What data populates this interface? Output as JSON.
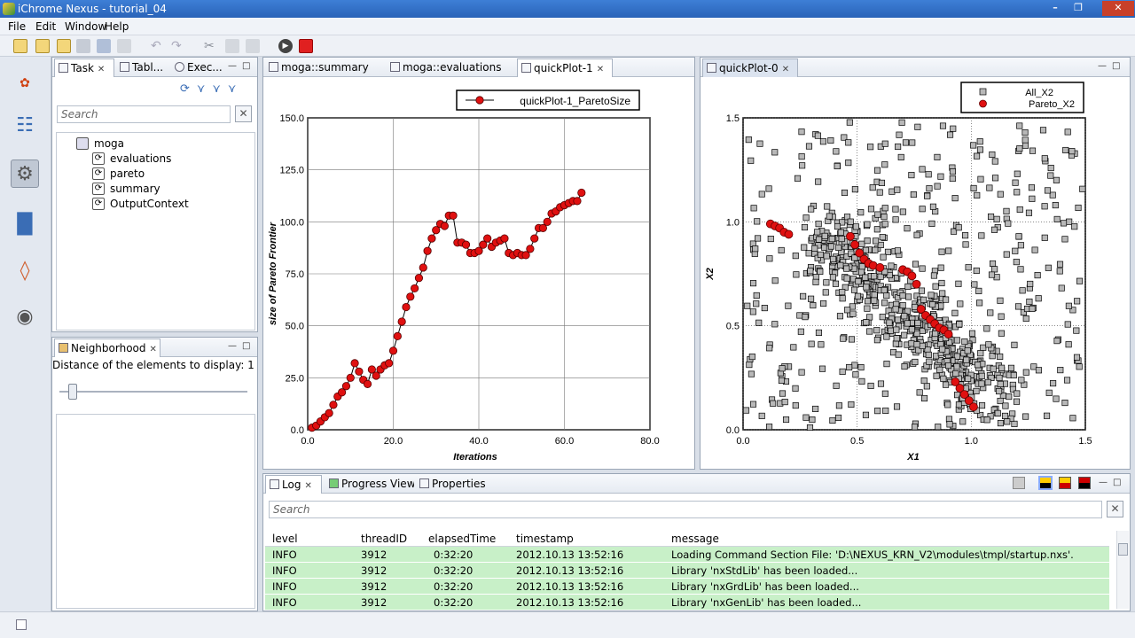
{
  "window": {
    "title": "iChrome Nexus - tutorial_04"
  },
  "menu": [
    "File",
    "Edit",
    "Window",
    "Help"
  ],
  "left_panel": {
    "tabs": [
      {
        "label": "Task",
        "active": true
      },
      {
        "label": "Tabl...",
        "active": false
      },
      {
        "label": "Exec...",
        "active": false
      }
    ],
    "search_placeholder": "Search",
    "tree": {
      "root": "moga",
      "children": [
        "evaluations",
        "pareto",
        "summary",
        "OutputContext"
      ]
    }
  },
  "neighborhood": {
    "tab": "Neighborhood",
    "label": "Distance of the elements to display: 1",
    "slider_value": 1
  },
  "editor_tabs": [
    {
      "label": "moga::summary",
      "active": false
    },
    {
      "label": "moga::evaluations",
      "active": false
    },
    {
      "label": "quickPlot-1",
      "active": true
    }
  ],
  "right_tab": {
    "label": "quickPlot-0"
  },
  "log": {
    "tabs": [
      "Log",
      "Progress View",
      "Properties"
    ],
    "search_placeholder": "Search",
    "columns": [
      "level",
      "threadID",
      "elapsedTime",
      "timestamp",
      "message"
    ],
    "rows": [
      [
        "INFO",
        "3912",
        "0:32:20",
        "2012.10.13 13:52:16",
        "Loading Command Section File: 'D:\\NEXUS_KRN_V2\\modules\\tmpl/startup.nxs'."
      ],
      [
        "INFO",
        "3912",
        "0:32:20",
        "2012.10.13 13:52:16",
        "Library 'nxStdLib' has been loaded..."
      ],
      [
        "INFO",
        "3912",
        "0:32:20",
        "2012.10.13 13:52:16",
        "Library 'nxGrdLib' has been loaded..."
      ],
      [
        "INFO",
        "3912",
        "0:32:20",
        "2012.10.13 13:52:16",
        "Library 'nxGenLib' has been loaded..."
      ]
    ]
  },
  "colors": {
    "accent": "#2a63b8",
    "log_row": "#c8f0c8",
    "marker_red": "#e01010",
    "marker_gray": "#b8b8b8"
  },
  "chart_data": [
    {
      "type": "line",
      "legend": [
        "quickPlot-1_ParetoSize"
      ],
      "legend_placement": "top-right",
      "xlabel": "Iterations",
      "ylabel": "size of Pareto Frontier",
      "xlim": [
        0,
        80
      ],
      "ylim": [
        0,
        150
      ],
      "xticks": [
        "0.0",
        "20.0",
        "40.0",
        "60.0",
        "80.0"
      ],
      "yticks": [
        "0.0",
        "25.0",
        "50.0",
        "75.0",
        "100.0",
        "125.0",
        "150.0"
      ],
      "grid": true,
      "series": [
        {
          "name": "quickPlot-1_ParetoSize",
          "x": [
            1,
            2,
            3,
            4,
            5,
            6,
            7,
            8,
            9,
            10,
            11,
            12,
            13,
            14,
            15,
            16,
            17,
            18,
            19,
            20,
            21,
            22,
            23,
            24,
            25,
            26,
            27,
            28,
            29,
            30,
            31,
            32,
            33,
            34,
            35,
            36,
            37,
            38,
            39,
            40,
            41,
            42,
            43,
            44,
            45,
            46,
            47,
            48,
            49,
            50,
            51,
            52,
            53,
            54,
            55,
            56,
            57,
            58,
            59,
            60,
            61,
            62,
            63,
            64
          ],
          "y": [
            1,
            2,
            4,
            6,
            8,
            12,
            16,
            18,
            21,
            25,
            32,
            28,
            24,
            22,
            29,
            26,
            29,
            31,
            32,
            38,
            45,
            52,
            59,
            64,
            68,
            73,
            78,
            86,
            92,
            96,
            99,
            98,
            103,
            103,
            90,
            90,
            89,
            85,
            85,
            86,
            89,
            92,
            88,
            90,
            91,
            92,
            85,
            84,
            85,
            84,
            84,
            87,
            92,
            97,
            97,
            100,
            104,
            105,
            107,
            108,
            109,
            110,
            110,
            114
          ]
        }
      ]
    },
    {
      "type": "scatter",
      "legend": [
        "All_X2",
        "Pareto_X2"
      ],
      "legend_placement": "top-right",
      "xlabel": "X1",
      "ylabel": "X2",
      "xlim": [
        0,
        1.5
      ],
      "ylim": [
        0,
        1.5
      ],
      "xticks": [
        "0.0",
        "0.5",
        "1.0",
        "1.5"
      ],
      "yticks": [
        "0.0",
        "0.5",
        "1.0",
        "1.5"
      ],
      "grid": true,
      "series": [
        {
          "name": "All_X2",
          "note_count": 900
        },
        {
          "name": "Pareto_X2",
          "x": [
            0.12,
            0.14,
            0.16,
            0.18,
            0.2,
            0.47,
            0.49,
            0.51,
            0.53,
            0.55,
            0.57,
            0.6,
            0.7,
            0.72,
            0.74,
            0.76,
            0.78,
            0.8,
            0.82,
            0.84,
            0.86,
            0.88,
            0.9,
            0.93,
            0.95,
            0.97,
            0.99,
            1.01
          ],
          "y": [
            0.99,
            0.98,
            0.97,
            0.95,
            0.94,
            0.93,
            0.89,
            0.85,
            0.82,
            0.8,
            0.79,
            0.78,
            0.77,
            0.76,
            0.74,
            0.7,
            0.58,
            0.55,
            0.53,
            0.51,
            0.49,
            0.48,
            0.46,
            0.23,
            0.2,
            0.17,
            0.14,
            0.11
          ]
        }
      ]
    }
  ]
}
